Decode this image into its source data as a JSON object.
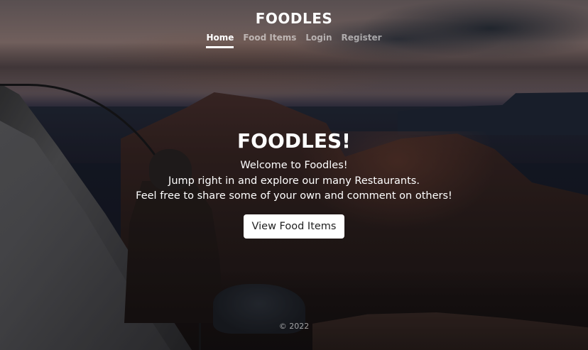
{
  "header": {
    "brand": "FOODLES",
    "nav": [
      {
        "label": "Home",
        "active": true
      },
      {
        "label": "Food Items",
        "active": false
      },
      {
        "label": "Login",
        "active": false
      },
      {
        "label": "Register",
        "active": false
      }
    ]
  },
  "hero": {
    "title": "FOODLES!",
    "lines": [
      "Welcome to Foodles!",
      "Jump right in and explore our many Restaurants.",
      "Feel free to share some of your own and comment on others!"
    ],
    "button_label": "View Food Items"
  },
  "footer": {
    "copyright": "© 2022"
  },
  "colors": {
    "text": "#ffffff",
    "button_bg": "#ffffff",
    "button_text": "#222222"
  }
}
